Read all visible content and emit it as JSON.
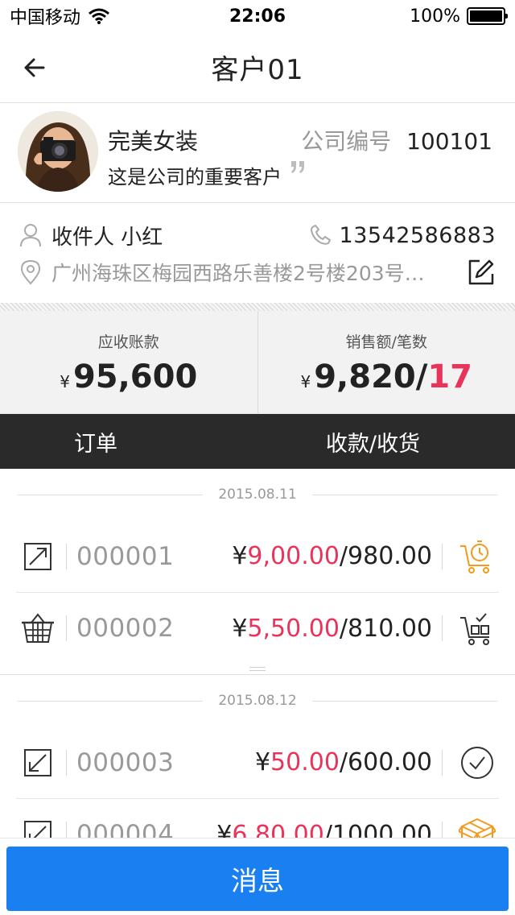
{
  "status_bar": {
    "carrier": "中国移动",
    "time": "22:06",
    "battery": "100%"
  },
  "nav": {
    "title": "客户01"
  },
  "customer": {
    "name": "完美女装",
    "company_id_label": "公司编号",
    "company_id": "100101",
    "description": "这是公司的重要客户"
  },
  "contact": {
    "receiver": "收件人 小红",
    "phone": "13542586883",
    "address": "广州海珠区梅园西路乐善楼2号楼203号…"
  },
  "stats": {
    "receivable_label": "应收账款",
    "currency": "¥",
    "receivable_value": "95,600",
    "sales_label": "销售额/笔数",
    "sales_value": "9,820/",
    "sales_count": "17"
  },
  "tabs": {
    "orders": "订单",
    "payment": "收款/收货"
  },
  "groups": [
    {
      "date": "2015.08.11",
      "orders": [
        {
          "no": "000001",
          "prefix": "¥",
          "paid": "9,00.00",
          "total": "/980.00",
          "type_icon": "external-link-icon",
          "status_icon": "cart-timer-icon"
        },
        {
          "no": "000002",
          "prefix": "¥",
          "paid": "5,50.00",
          "total": "/810.00",
          "type_icon": "basket-icon",
          "status_icon": "cart-check-icon"
        }
      ]
    },
    {
      "date": "2015.08.12",
      "orders": [
        {
          "no": "000003",
          "prefix": "¥",
          "paid": "50.00",
          "total": "/600.00",
          "type_icon": "arrow-in-icon",
          "status_icon": "check-circle-icon"
        },
        {
          "no": "000004",
          "prefix": "¥",
          "paid": "6,80.00",
          "total": "/1000.00",
          "type_icon": "arrow-in-icon",
          "status_icon": "box-icon"
        }
      ]
    }
  ],
  "colors": {
    "accent_red": "#e8345a",
    "primary_blue": "#1a7ff0",
    "tab_bar": "#2a2a2a",
    "orange": "#f39a1e"
  },
  "bottom": {
    "message_button": "消息"
  }
}
